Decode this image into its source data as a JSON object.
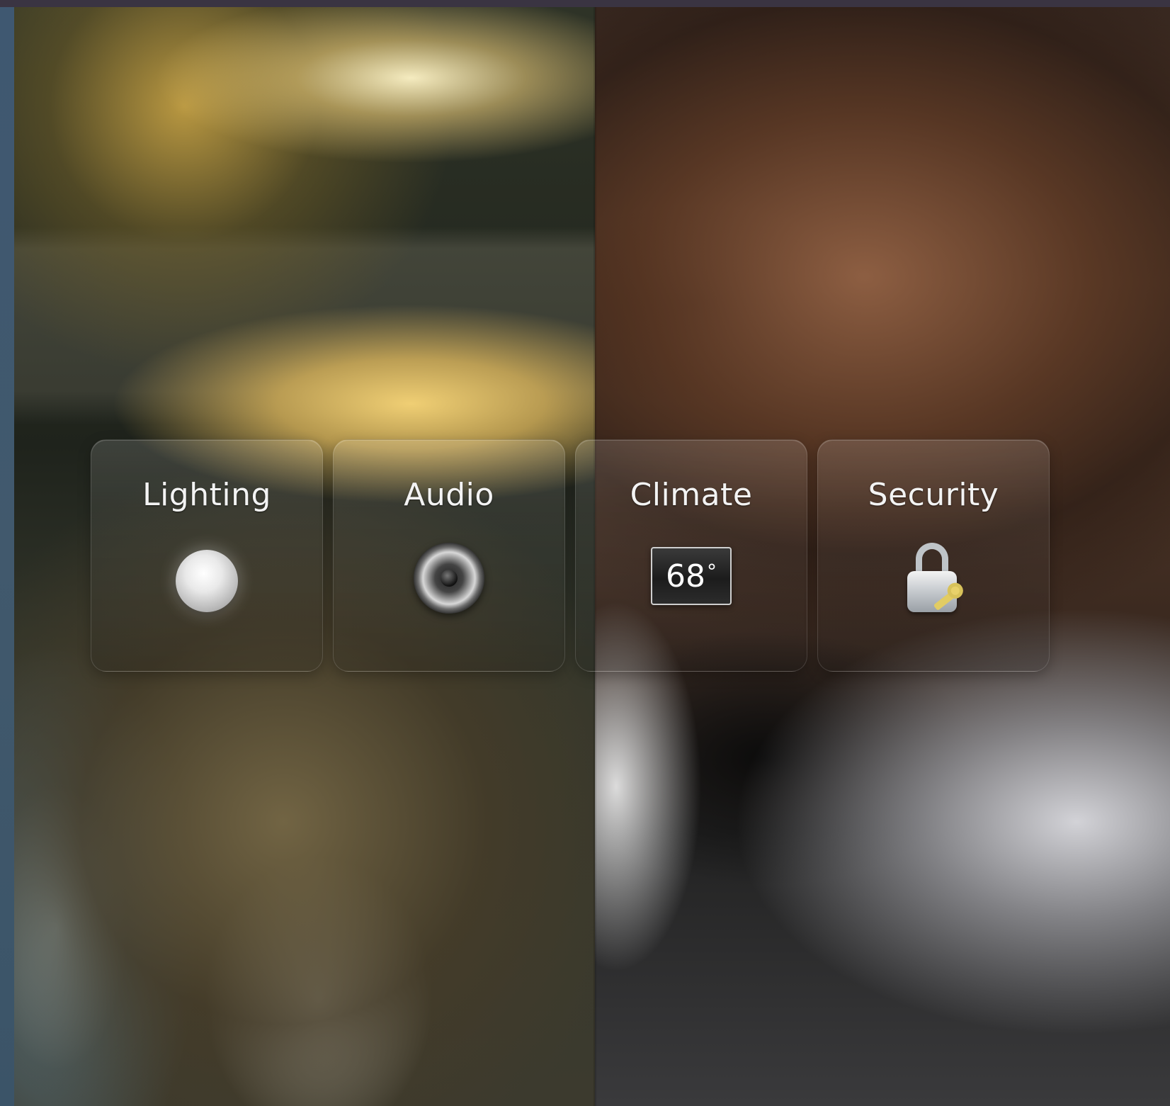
{
  "tiles": [
    {
      "label": "Lighting",
      "icon": "light-bulb-icon"
    },
    {
      "label": "Audio",
      "icon": "speaker-icon"
    },
    {
      "label": "Climate",
      "icon": "thermostat-icon",
      "temperature": "68",
      "unit": "°"
    },
    {
      "label": "Security",
      "icon": "padlock-icon"
    }
  ],
  "colors": {
    "frame_top": "#3a3442",
    "frame_side": "#3c566c",
    "tile_text": "#f3f3f3"
  }
}
